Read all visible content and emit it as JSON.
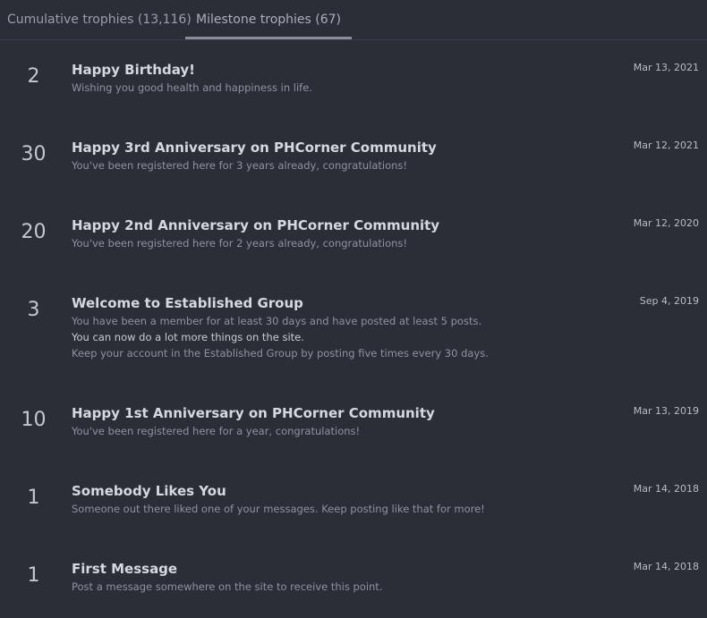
{
  "tabs": [
    {
      "label": "Cumulative trophies (13,116)"
    },
    {
      "label": "Milestone trophies (67)"
    }
  ],
  "trophies": [
    {
      "points": "2",
      "title": "Happy Birthday!",
      "lines": [
        "Wishing you good health and happiness in life."
      ],
      "date": "Mar 13, 2021"
    },
    {
      "points": "30",
      "title": "Happy 3rd Anniversary on PHCorner Community",
      "lines": [
        "You've been registered here for 3 years already, congratulations!"
      ],
      "date": "Mar 12, 2021"
    },
    {
      "points": "20",
      "title": "Happy 2nd Anniversary on PHCorner Community",
      "lines": [
        "You've been registered here for 2 years already, congratulations!"
      ],
      "date": "Mar 12, 2020"
    },
    {
      "points": "3",
      "title": "Welcome to Established Group",
      "lines": [
        "You have been a member for at least 30 days and have posted at least 5 posts.",
        "You can now do a lot more things on the site.",
        "Keep your account in the Established Group by posting five times every 30 days."
      ],
      "date": "Sep 4, 2019"
    },
    {
      "points": "10",
      "title": "Happy 1st Anniversary on PHCorner Community",
      "lines": [
        "You've been registered here for a year, congratulations!"
      ],
      "date": "Mar 13, 2019"
    },
    {
      "points": "1",
      "title": "Somebody Likes You",
      "lines": [
        "Someone out there liked one of your messages. Keep posting like that for more!"
      ],
      "date": "Mar 14, 2018"
    },
    {
      "points": "1",
      "title": "First Message",
      "lines": [
        "Post a message somewhere on the site to receive this point."
      ],
      "date": "Mar 14, 2018"
    }
  ]
}
